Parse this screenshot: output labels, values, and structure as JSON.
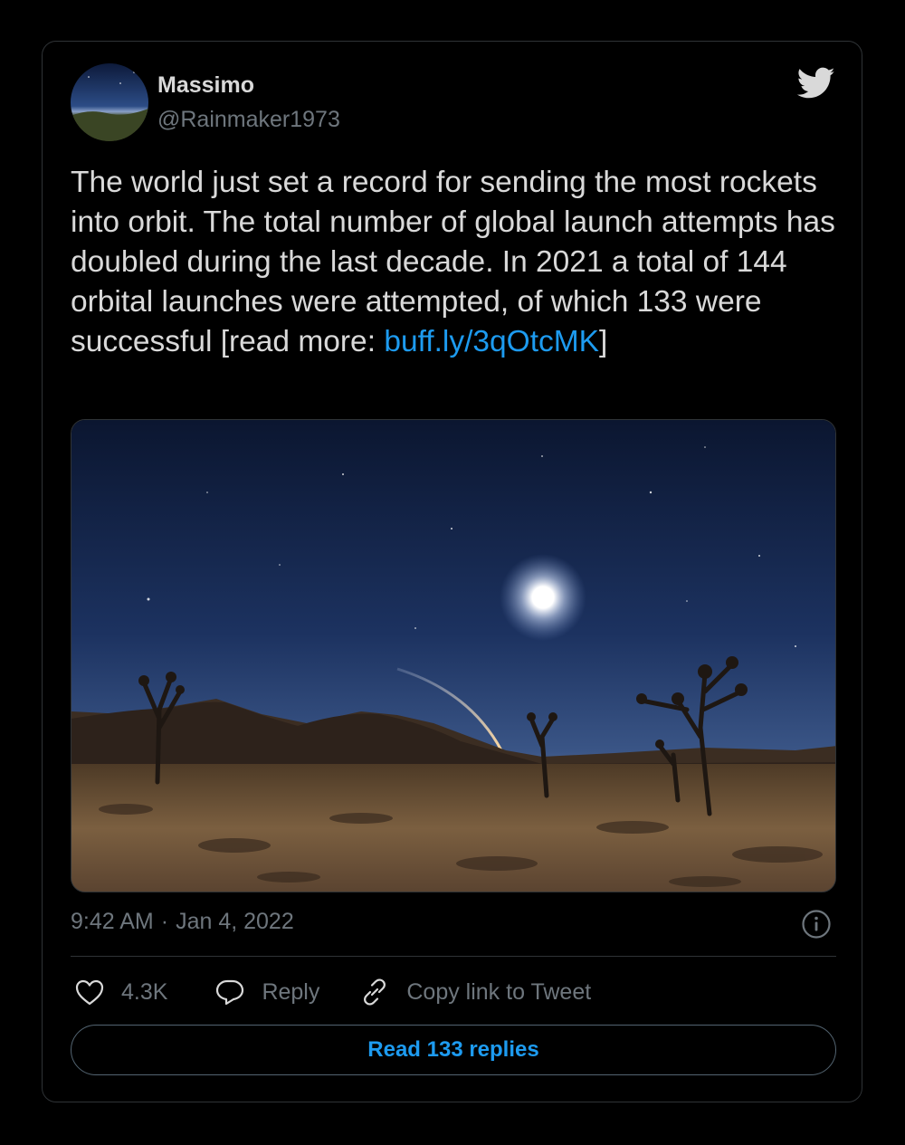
{
  "tweet": {
    "author_name": "Massimo",
    "author_handle": "@Rainmaker1973",
    "text_parts": {
      "body": "The world just set a record for sending the most rockets into orbit. The total number of global launch attempts has doubled during the last decade. In 2021 a total of 144 orbital launches were attempted, of which 133 were successful [read more: ",
      "link": "buff.ly/3qOtcMK",
      "tail": "]"
    },
    "time": "9:42 AM",
    "separator": "·",
    "date": "Jan 4, 2022"
  },
  "actions": {
    "like_count": "4.3K",
    "reply_label": "Reply",
    "copy_label": "Copy link to Tweet"
  },
  "read_replies_label": "Read 133 replies",
  "icons": {
    "brand": "twitter-bird-icon",
    "like": "heart-icon",
    "reply": "speech-bubble-icon",
    "copy": "link-icon",
    "info": "info-icon"
  },
  "colors": {
    "link": "#1d9bf0",
    "muted": "#6e767d",
    "text": "#d9d9d9",
    "background": "#000000"
  }
}
